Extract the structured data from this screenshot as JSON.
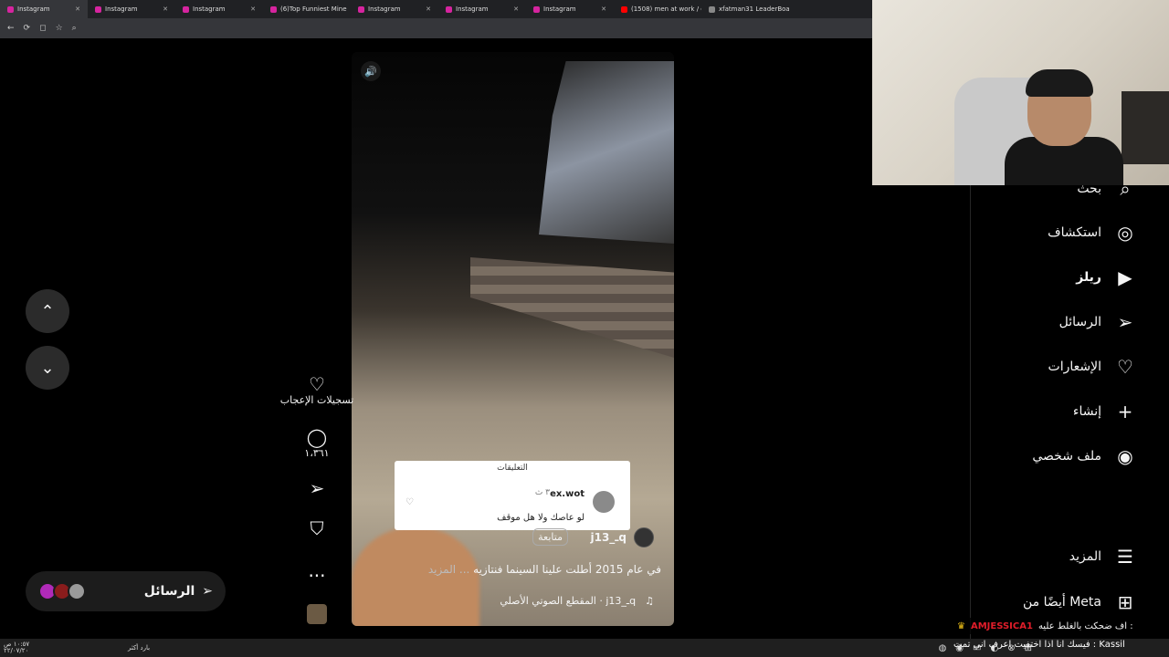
{
  "browser": {
    "tabs": [
      {
        "label": "Instagram",
        "active": true
      },
      {
        "label": "Instagram"
      },
      {
        "label": "Instagram"
      },
      {
        "label": "(6)Top Funniest Mine"
      },
      {
        "label": "Instagram"
      },
      {
        "label": "Instagram"
      },
      {
        "label": "Instagram"
      },
      {
        "label": "(1508) men at work / c"
      },
      {
        "label": "xfatman31 LeaderBoa"
      }
    ]
  },
  "reel": {
    "comment_popup": {
      "title": "التعليقات",
      "username": "ex.wot",
      "time": "٣ ث",
      "text": "لو عاصك ولا هل موقف"
    },
    "author": "j13_ـq",
    "follow_label": "متابعة",
    "caption": "في عام 2015 أطلت علينا السينما فنتازيه",
    "caption_more": "... المزيد",
    "audio": "المقطع الصوتي الأصلي · j13_ـq"
  },
  "actions": {
    "likes_label": "تسجيلات الإعجاب",
    "comments_count": "١،٣٦١",
    "more": "..."
  },
  "messages_bar": {
    "label": "الرسائل"
  },
  "sidebar": {
    "items": [
      {
        "label": "بحث",
        "icon": "search-icon"
      },
      {
        "label": "استكشاف",
        "icon": "compass-icon"
      },
      {
        "label": "ريلز",
        "icon": "reels-icon"
      },
      {
        "label": "الرسائل",
        "icon": "send-icon"
      },
      {
        "label": "الإشعارات",
        "icon": "heart-icon"
      },
      {
        "label": "إنشاء",
        "icon": "plus-icon"
      },
      {
        "label": "ملف شخصي",
        "icon": "profile-icon"
      },
      {
        "label": "المزيد",
        "icon": "menu-icon"
      },
      {
        "label": "أيضًا من Meta",
        "icon": "apps-icon"
      }
    ]
  },
  "stream_chat": {
    "message": "اف ضحكت بالغلط عليه :",
    "username": "AMJESSICA1"
  },
  "ticker": "فيسك انا اذا اختفيت اعرف اني تمت : Kassil",
  "taskbar": {
    "time": "١٠:٥٧ ص",
    "date": "٢٢/٠٧/٢٠",
    "weather": "بارد أكثر"
  }
}
